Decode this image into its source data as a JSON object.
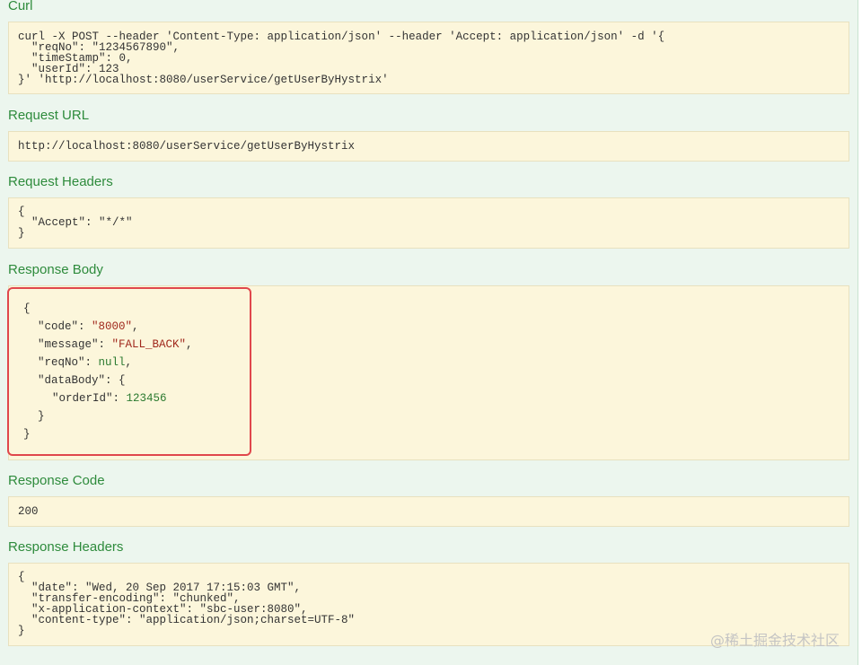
{
  "curl": {
    "heading": "Curl",
    "lines": [
      "curl -X POST --header 'Content-Type: application/json' --header 'Accept: application/json' -d '{",
      "  \"reqNo\": \"1234567890\",",
      "  \"timeStamp\": 0,",
      "  \"userId\": 123",
      "}' 'http://localhost:8080/userService/getUserByHystrix'"
    ]
  },
  "request_url": {
    "heading": "Request URL",
    "value": "http://localhost:8080/userService/getUserByHystrix"
  },
  "request_headers": {
    "heading": "Request Headers",
    "lines": [
      "{",
      "  \"Accept\": \"*/*\"",
      "}"
    ]
  },
  "response_body": {
    "heading": "Response Body",
    "open_brace": "{",
    "close_brace": "}",
    "code_key": "\"code\"",
    "code_value": "\"8000\"",
    "message_key": "\"message\"",
    "message_value": "\"FALL_BACK\"",
    "reqno_key": "\"reqNo\"",
    "reqno_value": "null",
    "databody_key": "\"dataBody\"",
    "databody_open": "{",
    "databody_close": "}",
    "orderid_key": "\"orderId\"",
    "orderid_value": "123456"
  },
  "response_code": {
    "heading": "Response Code",
    "value": "200"
  },
  "response_headers": {
    "heading": "Response Headers",
    "lines": [
      "{",
      "  \"date\": \"Wed, 20 Sep 2017 17:15:03 GMT\",",
      "  \"transfer-encoding\": \"chunked\",",
      "  \"x-application-context\": \"sbc-user:8080\",",
      "  \"content-type\": \"application/json;charset=UTF-8\"",
      "}"
    ]
  },
  "watermark": "@稀土掘金技术社区",
  "colors": {
    "heading": "#2e8b3c",
    "box_bg": "#fcf6db",
    "panel_bg": "#ecf6ee",
    "highlight": "#e0474c",
    "string": "#a0281c",
    "number": "#2b7a2f"
  }
}
